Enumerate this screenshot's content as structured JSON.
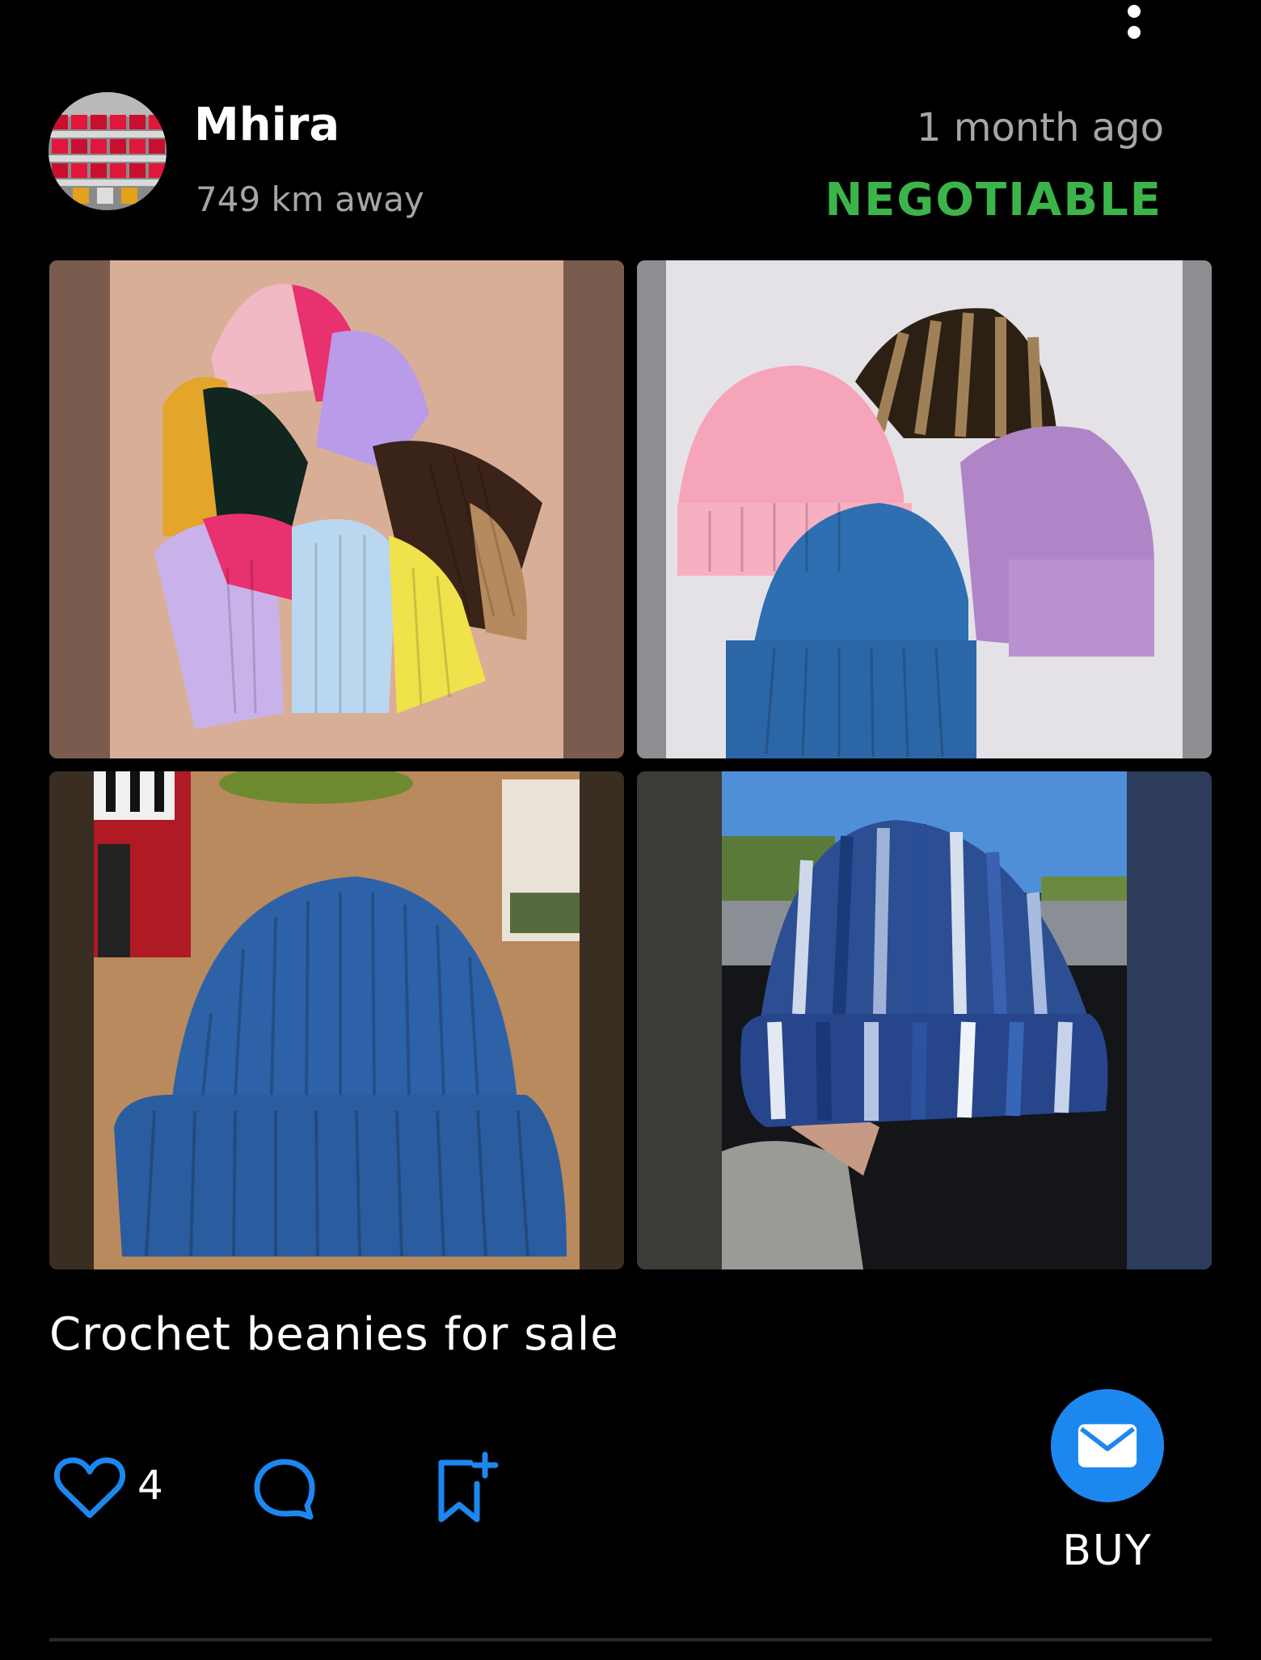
{
  "listing": {
    "seller_name": "Mhira",
    "distance": "749 km away",
    "posted": "1 month ago",
    "price_status": "NEGOTIABLE",
    "caption": "Crochet beanies for sale",
    "like_count": "4",
    "buy_label": "BUY"
  },
  "photos": [
    {
      "subject": "assorted-ribbed-beanies"
    },
    {
      "subject": "pink-brown-lilac-blue-beanies"
    },
    {
      "subject": "blue-ribbed-beanie"
    },
    {
      "subject": "variegated-blue-beanie"
    }
  ],
  "icons": {
    "more": "more-vertical-icon",
    "like": "heart-icon",
    "comment": "comment-icon",
    "save": "bookmark-add-icon",
    "buy": "mail-icon"
  },
  "colors": {
    "background": "#000000",
    "accent_blue": "#1d87f0",
    "negotiable_green": "#3bb54a",
    "muted_text": "#a6a6a6"
  }
}
